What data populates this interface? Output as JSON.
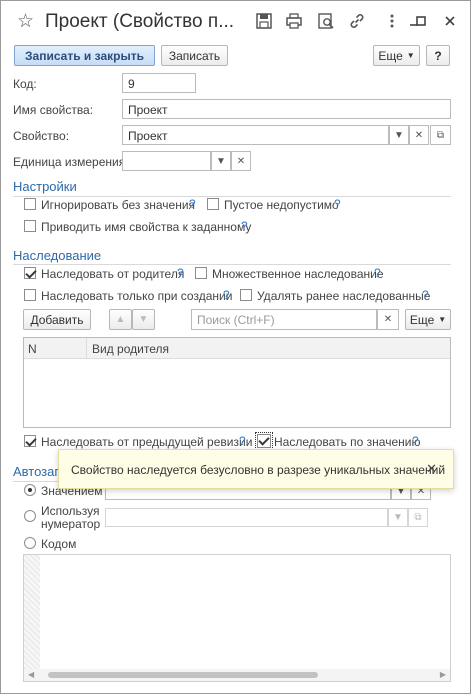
{
  "window": {
    "title": "Проект (Свойство п...",
    "icons": [
      "star-icon",
      "save-icon",
      "print-icon",
      "preview-icon",
      "link-icon",
      "more-icon",
      "minimize-icon",
      "maximize-icon",
      "close-icon"
    ]
  },
  "toolbar": {
    "save_close": "Записать и закрыть",
    "save": "Записать",
    "more": "Еще",
    "help": "?"
  },
  "fields": {
    "code_label": "Код:",
    "code_value": "9",
    "name_label": "Имя свойства:",
    "name_value": "Проект",
    "property_label": "Свойство:",
    "property_value": "Проект",
    "unit_label": "Единица измерения:",
    "unit_value": ""
  },
  "settings": {
    "title": "Настройки",
    "ignore_empty": "Игнорировать без значения",
    "empty_invalid": "Пустое недопустимо",
    "coerce_name": "Приводить имя свойства к заданному"
  },
  "inheritance": {
    "title": "Наследование",
    "inherit_parent": "Наследовать от родителя",
    "multiple": "Множественное наследование",
    "only_on_create": "Наследовать только при создании",
    "delete_previous": "Удалять ранее наследованные",
    "add_button": "Добавить",
    "search_placeholder": "Поиск (Ctrl+F)",
    "more": "Еще",
    "columns": [
      "N",
      "Вид родителя"
    ],
    "inherit_prev_revision": "Наследовать от предыдущей ревизии",
    "inherit_by_value": "Наследовать по значению"
  },
  "tooltip": {
    "text": "Свойство наследуется безусловно в разрезе уникальных значений"
  },
  "autofill": {
    "title": "Автозап",
    "by_value": "Значением",
    "by_numerator_1": "Используя",
    "by_numerator_2": "нумератор",
    "by_code": "Кодом"
  }
}
